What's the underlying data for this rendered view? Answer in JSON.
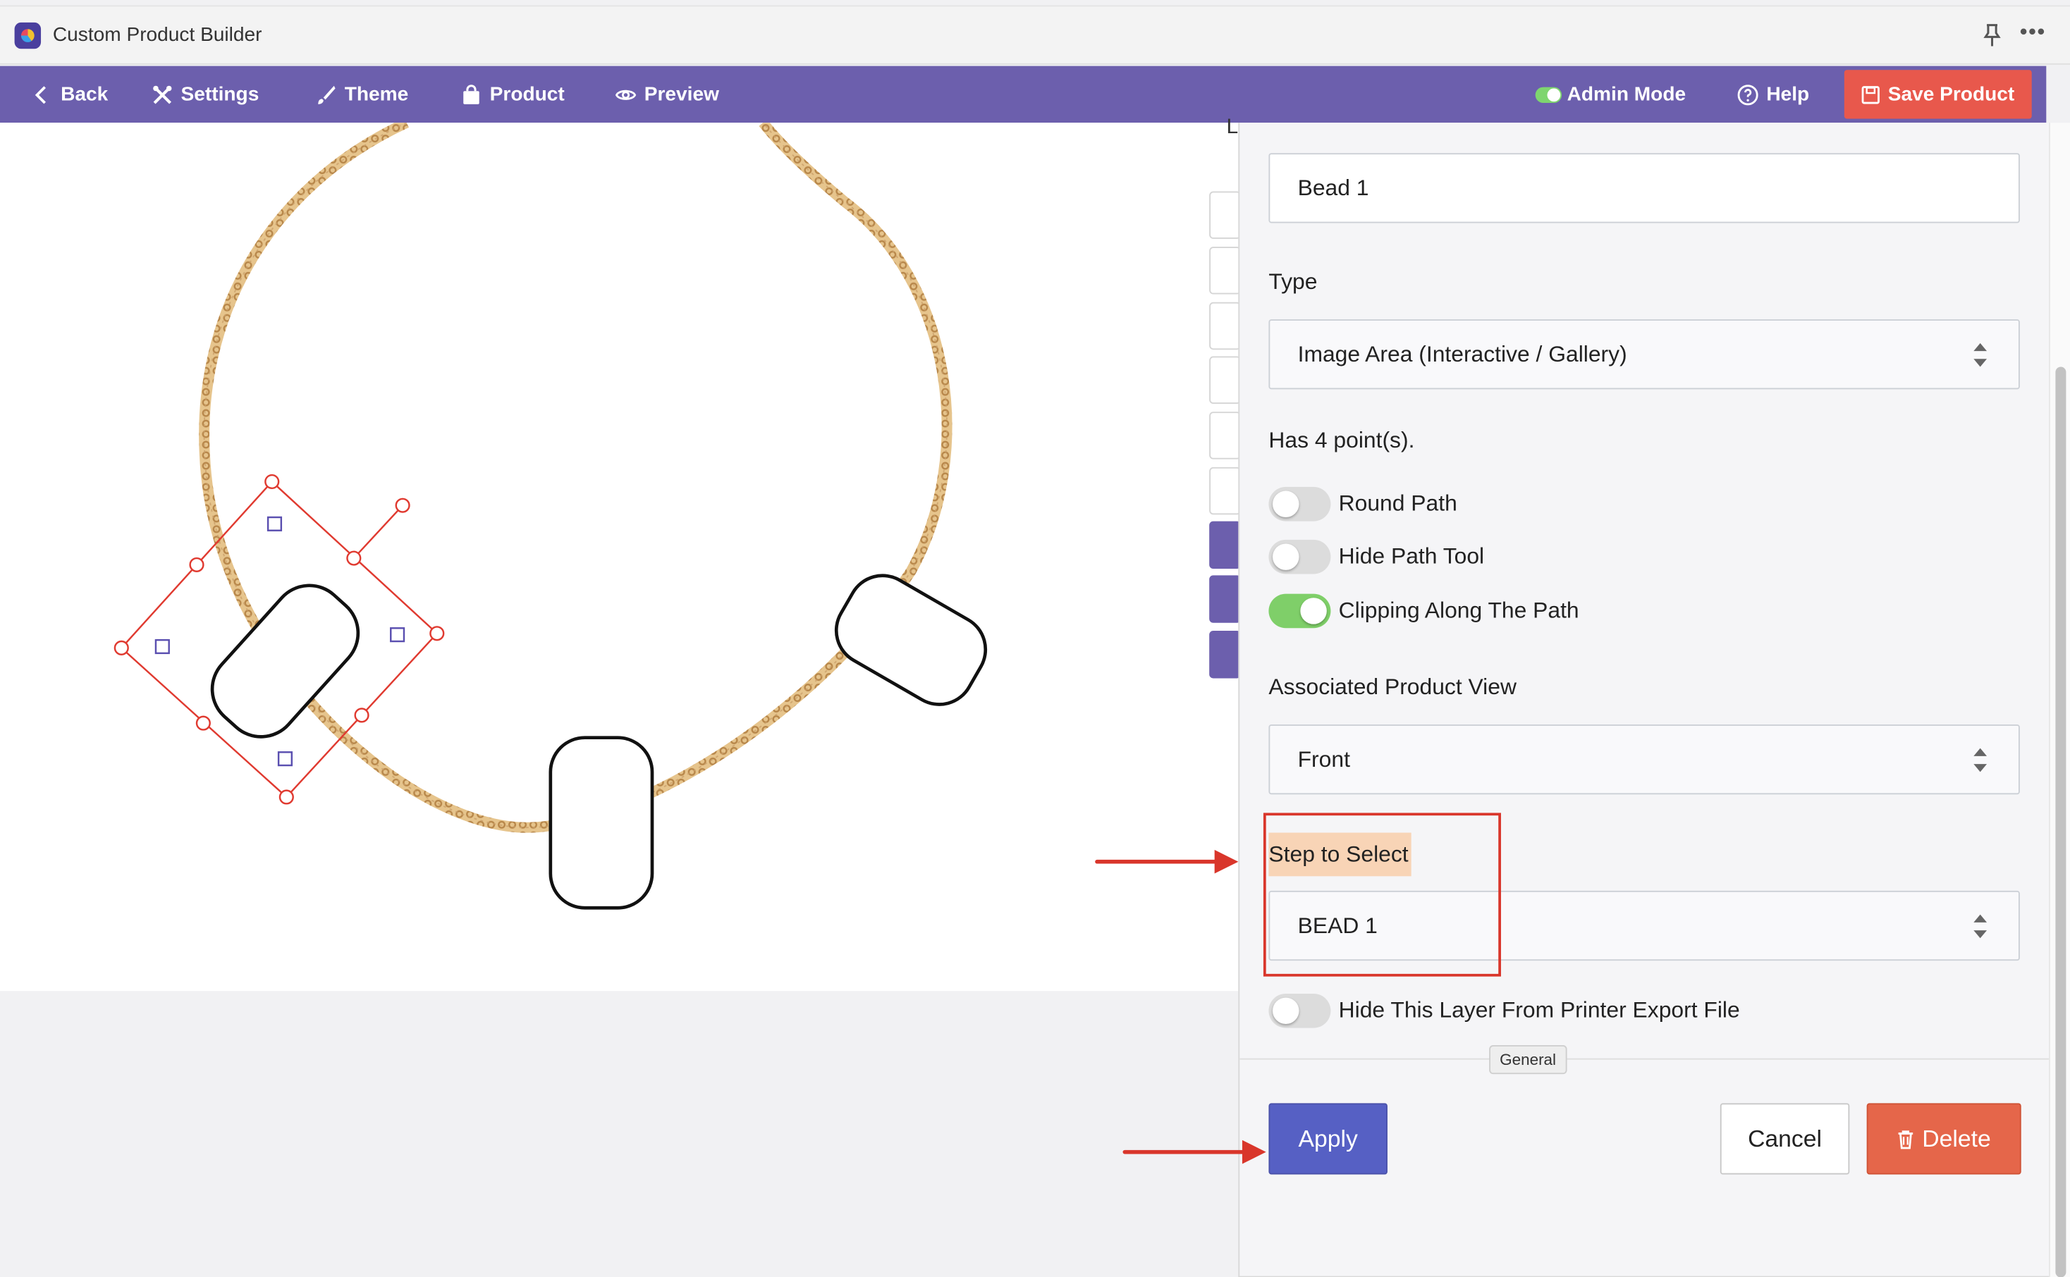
{
  "app": {
    "title": "Custom Product Builder"
  },
  "toolbar": {
    "back": "Back",
    "settings": "Settings",
    "theme": "Theme",
    "product": "Product",
    "preview": "Preview",
    "admin_mode": "Admin Mode",
    "help": "Help",
    "save_product": "Save Product"
  },
  "panel": {
    "title_value": "Bead 1",
    "type_label": "Type",
    "type_value": "Image Area (Interactive / Gallery)",
    "points_text": "Has 4 point(s).",
    "toggles": [
      {
        "label": "Round Path",
        "on": false
      },
      {
        "label": "Hide Path Tool",
        "on": false
      },
      {
        "label": "Clipping Along The Path",
        "on": true
      }
    ],
    "view_label": "Associated Product View",
    "view_value": "Front",
    "step_label": "Step to Select",
    "step_value": "BEAD 1",
    "hide_layer_label": "Hide This Layer From Printer Export File",
    "hide_layer_on": false,
    "tooltip": "General",
    "apply": "Apply",
    "cancel": "Cancel",
    "delete": "Delete"
  },
  "colors": {
    "toolbar": "#6c5fad",
    "save": "#e8584c",
    "apply": "#5660c4",
    "delete": "#e5664a",
    "annotation": "#d9362b",
    "highlight": "#f8d4b6"
  }
}
